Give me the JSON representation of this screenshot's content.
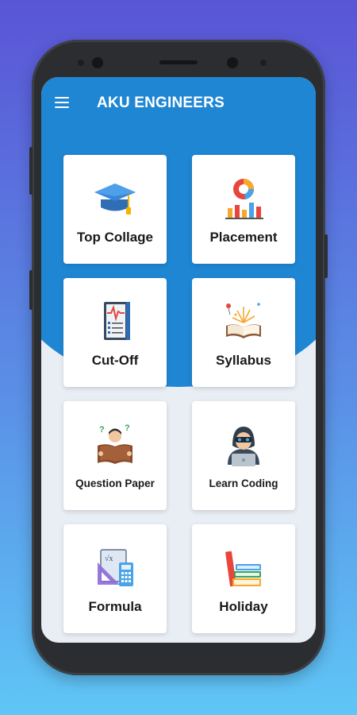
{
  "app": {
    "title": "AKU ENGINEERS"
  },
  "header": {
    "menu_icon": "hamburger-menu-icon"
  },
  "menu_items": [
    {
      "label": "Top Collage",
      "icon": "graduation-cap-icon"
    },
    {
      "label": "Placement",
      "icon": "chart-icon"
    },
    {
      "label": "Cut-Off",
      "icon": "report-icon"
    },
    {
      "label": "Syllabus",
      "icon": "open-book-icon"
    },
    {
      "label": "Question Paper",
      "icon": "student-reading-icon"
    },
    {
      "label": "Learn Coding",
      "icon": "hacker-coder-icon"
    },
    {
      "label": "Formula",
      "icon": "math-tools-icon"
    },
    {
      "label": "Holiday",
      "icon": "books-stack-icon"
    }
  ],
  "colors": {
    "header_blue": "#1f86d3",
    "screen_bg": "#e9eef4",
    "card_bg": "#ffffff",
    "bg_gradient_top": "#5a55d6",
    "bg_gradient_bottom": "#5fc6f6"
  }
}
